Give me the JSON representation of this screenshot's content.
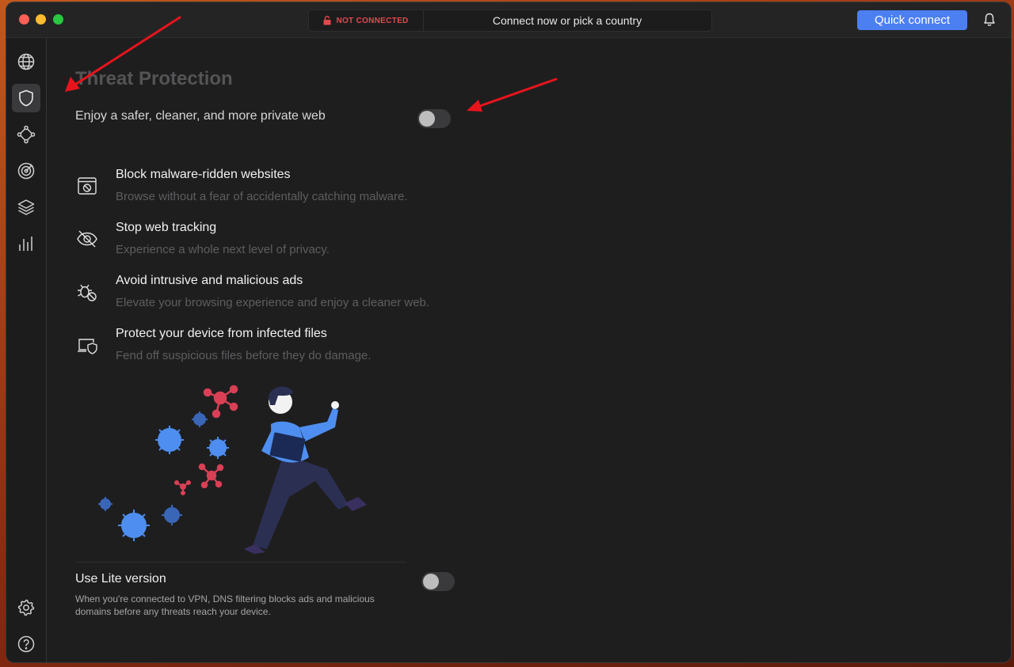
{
  "titlebar": {
    "status": "NOT CONNECTED",
    "connect_prompt": "Connect now or pick a country",
    "quick_connect_label": "Quick connect",
    "status_color": "#e5484d",
    "accent_color": "#4c7ff2"
  },
  "sidebar": {
    "items": [
      {
        "name": "globe",
        "icon": "globe-icon",
        "active": false
      },
      {
        "name": "threat-protection",
        "icon": "shield-icon",
        "active": true
      },
      {
        "name": "meshnet",
        "icon": "meshnet-icon",
        "active": false
      },
      {
        "name": "dark-web-monitor",
        "icon": "target-icon",
        "active": false
      },
      {
        "name": "split-tunneling",
        "icon": "layers-icon",
        "active": false
      },
      {
        "name": "statistics",
        "icon": "bar-chart-icon",
        "active": false
      }
    ],
    "bottom_items": [
      {
        "name": "settings",
        "icon": "gear-icon"
      },
      {
        "name": "help",
        "icon": "help-icon"
      }
    ]
  },
  "main": {
    "title": "Threat Protection",
    "subtitle": "Enjoy a safer, cleaner, and more private web",
    "protection_enabled": false,
    "features": [
      {
        "icon": "block-website-icon",
        "title": "Block malware-ridden websites",
        "description": "Browse without a fear of accidentally catching malware."
      },
      {
        "icon": "eye-off-icon",
        "title": "Stop web tracking",
        "description": "Experience a whole next level of privacy."
      },
      {
        "icon": "bug-block-icon",
        "title": "Avoid intrusive and malicious ads",
        "description": "Elevate your browsing experience and enjoy a cleaner web."
      },
      {
        "icon": "device-shield-icon",
        "title": "Protect your device from infected files",
        "description": "Fend off suspicious files before they do damage."
      }
    ],
    "lite": {
      "title": "Use Lite version",
      "description": "When you're connected to VPN, DNS filtering blocks ads and malicious domains before any threats reach your device.",
      "enabled": false
    }
  }
}
